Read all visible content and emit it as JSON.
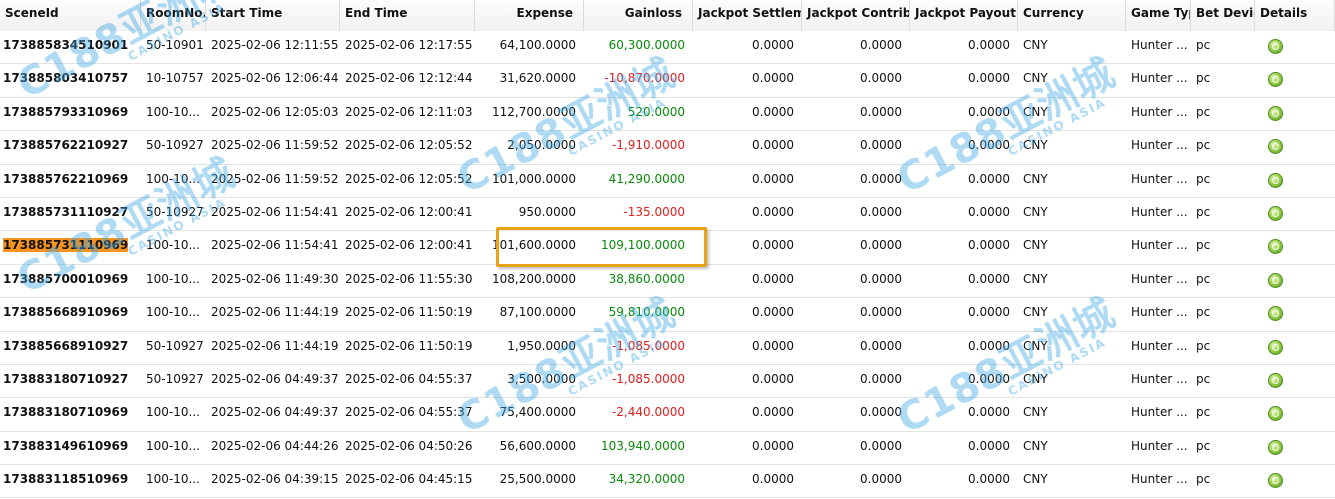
{
  "columns": [
    {
      "label": "SceneId",
      "align": "l"
    },
    {
      "label": "RoomNo...",
      "align": "l"
    },
    {
      "label": "Start Time",
      "align": "l"
    },
    {
      "label": "End Time",
      "align": "l"
    },
    {
      "label": "Expense",
      "align": "r"
    },
    {
      "label": "Gainloss",
      "align": "r"
    },
    {
      "label": "Jackpot Settleme",
      "align": "l"
    },
    {
      "label": "Jackpot Contribu",
      "align": "l"
    },
    {
      "label": "Jackpot Payout",
      "align": "l"
    },
    {
      "label": "Currency",
      "align": "l"
    },
    {
      "label": "Game Typ",
      "align": "l"
    },
    {
      "label": "Bet Devic",
      "align": "l"
    },
    {
      "label": "Details",
      "align": "l"
    }
  ],
  "rows": [
    {
      "scene_id": "173885834510901",
      "room": "50-10901",
      "start": "2025-02-06 12:11:55",
      "end": "2025-02-06 12:17:55",
      "expense": "64,100.0000",
      "gainloss": "60,300.0000",
      "gl_sign": "pos",
      "jp_settle": "0.0000",
      "jp_contrib": "0.0000",
      "jp_payout": "0.0000",
      "currency": "CNY",
      "game_type": "Hunter ...",
      "bet_device": "pc",
      "highlight": false
    },
    {
      "scene_id": "173885803410757",
      "room": "10-10757",
      "start": "2025-02-06 12:06:44",
      "end": "2025-02-06 12:12:44",
      "expense": "31,620.0000",
      "gainloss": "-10,870.0000",
      "gl_sign": "neg",
      "jp_settle": "0.0000",
      "jp_contrib": "0.0000",
      "jp_payout": "0.0000",
      "currency": "CNY",
      "game_type": "Hunter ...",
      "bet_device": "pc",
      "highlight": false
    },
    {
      "scene_id": "173885793310969",
      "room": "100-10...",
      "start": "2025-02-06 12:05:03",
      "end": "2025-02-06 12:11:03",
      "expense": "112,700.0000",
      "gainloss": "520.0000",
      "gl_sign": "pos",
      "jp_settle": "0.0000",
      "jp_contrib": "0.0000",
      "jp_payout": "0.0000",
      "currency": "CNY",
      "game_type": "Hunter ...",
      "bet_device": "pc",
      "highlight": false
    },
    {
      "scene_id": "173885762210927",
      "room": "50-10927",
      "start": "2025-02-06 11:59:52",
      "end": "2025-02-06 12:05:52",
      "expense": "2,050.0000",
      "gainloss": "-1,910.0000",
      "gl_sign": "neg",
      "jp_settle": "0.0000",
      "jp_contrib": "0.0000",
      "jp_payout": "0.0000",
      "currency": "CNY",
      "game_type": "Hunter ...",
      "bet_device": "pc",
      "highlight": false
    },
    {
      "scene_id": "173885762210969",
      "room": "100-10...",
      "start": "2025-02-06 11:59:52",
      "end": "2025-02-06 12:05:52",
      "expense": "101,000.0000",
      "gainloss": "41,290.0000",
      "gl_sign": "pos",
      "jp_settle": "0.0000",
      "jp_contrib": "0.0000",
      "jp_payout": "0.0000",
      "currency": "CNY",
      "game_type": "Hunter ...",
      "bet_device": "pc",
      "highlight": false
    },
    {
      "scene_id": "173885731110927",
      "room": "50-10927",
      "start": "2025-02-06 11:54:41",
      "end": "2025-02-06 12:00:41",
      "expense": "950.0000",
      "gainloss": "-135.0000",
      "gl_sign": "neg",
      "jp_settle": "0.0000",
      "jp_contrib": "0.0000",
      "jp_payout": "0.0000",
      "currency": "CNY",
      "game_type": "Hunter ...",
      "bet_device": "pc",
      "highlight": false
    },
    {
      "scene_id": "173885731110969",
      "room": "100-10...",
      "start": "2025-02-06 11:54:41",
      "end": "2025-02-06 12:00:41",
      "expense": "101,600.0000",
      "gainloss": "109,100.0000",
      "gl_sign": "pos",
      "jp_settle": "0.0000",
      "jp_contrib": "0.0000",
      "jp_payout": "0.0000",
      "currency": "CNY",
      "game_type": "Hunter ...",
      "bet_device": "pc",
      "highlight": true
    },
    {
      "scene_id": "173885700010969",
      "room": "100-10...",
      "start": "2025-02-06 11:49:30",
      "end": "2025-02-06 11:55:30",
      "expense": "108,200.0000",
      "gainloss": "38,860.0000",
      "gl_sign": "pos",
      "jp_settle": "0.0000",
      "jp_contrib": "0.0000",
      "jp_payout": "0.0000",
      "currency": "CNY",
      "game_type": "Hunter ...",
      "bet_device": "pc",
      "highlight": false
    },
    {
      "scene_id": "173885668910969",
      "room": "100-10...",
      "start": "2025-02-06 11:44:19",
      "end": "2025-02-06 11:50:19",
      "expense": "87,100.0000",
      "gainloss": "59,810.0000",
      "gl_sign": "pos",
      "jp_settle": "0.0000",
      "jp_contrib": "0.0000",
      "jp_payout": "0.0000",
      "currency": "CNY",
      "game_type": "Hunter ...",
      "bet_device": "pc",
      "highlight": false
    },
    {
      "scene_id": "173885668910927",
      "room": "50-10927",
      "start": "2025-02-06 11:44:19",
      "end": "2025-02-06 11:50:19",
      "expense": "1,950.0000",
      "gainloss": "-1,085.0000",
      "gl_sign": "neg",
      "jp_settle": "0.0000",
      "jp_contrib": "0.0000",
      "jp_payout": "0.0000",
      "currency": "CNY",
      "game_type": "Hunter ...",
      "bet_device": "pc",
      "highlight": false
    },
    {
      "scene_id": "173883180710927",
      "room": "50-10927",
      "start": "2025-02-06 04:49:37",
      "end": "2025-02-06 04:55:37",
      "expense": "3,500.0000",
      "gainloss": "-1,085.0000",
      "gl_sign": "neg",
      "jp_settle": "0.0000",
      "jp_contrib": "0.0000",
      "jp_payout": "0.0000",
      "currency": "CNY",
      "game_type": "Hunter ...",
      "bet_device": "pc",
      "highlight": false
    },
    {
      "scene_id": "173883180710969",
      "room": "100-10...",
      "start": "2025-02-06 04:49:37",
      "end": "2025-02-06 04:55:37",
      "expense": "75,400.0000",
      "gainloss": "-2,440.0000",
      "gl_sign": "neg",
      "jp_settle": "0.0000",
      "jp_contrib": "0.0000",
      "jp_payout": "0.0000",
      "currency": "CNY",
      "game_type": "Hunter ...",
      "bet_device": "pc",
      "highlight": false
    },
    {
      "scene_id": "173883149610969",
      "room": "100-10...",
      "start": "2025-02-06 04:44:26",
      "end": "2025-02-06 04:50:26",
      "expense": "56,600.0000",
      "gainloss": "103,940.0000",
      "gl_sign": "pos",
      "jp_settle": "0.0000",
      "jp_contrib": "0.0000",
      "jp_payout": "0.0000",
      "currency": "CNY",
      "game_type": "Hunter ...",
      "bet_device": "pc",
      "highlight": false
    },
    {
      "scene_id": "173883118510969",
      "room": "100-10...",
      "start": "2025-02-06 04:39:15",
      "end": "2025-02-06 04:45:15",
      "expense": "25,500.0000",
      "gainloss": "34,320.0000",
      "gl_sign": "pos",
      "jp_settle": "0.0000",
      "jp_contrib": "0.0000",
      "jp_payout": "0.0000",
      "currency": "CNY",
      "game_type": "Hunter ...",
      "bet_device": "pc",
      "highlight": false
    }
  ],
  "details_icon": "magnifier-icon",
  "watermark": {
    "brand": "C188亚洲城",
    "tagline": "CASINO ASIA"
  },
  "colors": {
    "positive": "#0a8a0a",
    "negative": "#e02020",
    "scene_highlight": "#f7931e",
    "callout_border": "#e8a317",
    "watermark": "#40a8e6"
  }
}
